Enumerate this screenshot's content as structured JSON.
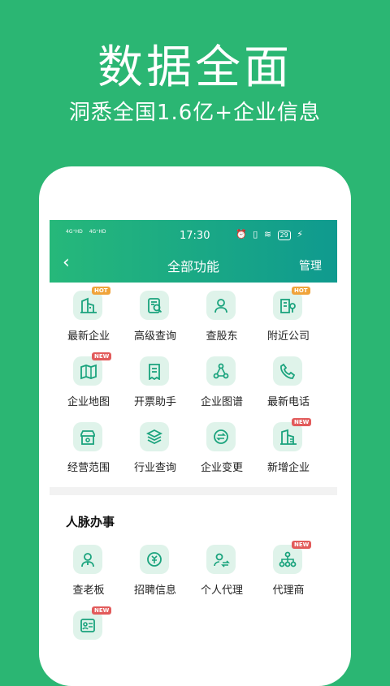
{
  "promo": {
    "title": "数据全面",
    "subtitle": "洞悉全国1.6亿+企业信息"
  },
  "status_bar": {
    "signal_1": "4G⁺HD",
    "signal_2": "4G⁺HD",
    "time": "17:30",
    "battery": "29"
  },
  "nav": {
    "back": "‹",
    "title": "全部功能",
    "manage": "管理"
  },
  "grid1": [
    {
      "label": "最新企业",
      "icon": "building-icon",
      "badge": "HOT"
    },
    {
      "label": "高级查询",
      "icon": "search-doc-icon",
      "badge": ""
    },
    {
      "label": "查股东",
      "icon": "person-icon",
      "badge": ""
    },
    {
      "label": "附近公司",
      "icon": "location-building-icon",
      "badge": "HOT"
    },
    {
      "label": "企业地图",
      "icon": "map-icon",
      "badge": "NEW"
    },
    {
      "label": "开票助手",
      "icon": "receipt-icon",
      "badge": ""
    },
    {
      "label": "企业图谱",
      "icon": "graph-icon",
      "badge": ""
    },
    {
      "label": "最新电话",
      "icon": "phone-icon",
      "badge": ""
    },
    {
      "label": "经营范围",
      "icon": "store-icon",
      "badge": ""
    },
    {
      "label": "行业查询",
      "icon": "layers-icon",
      "badge": ""
    },
    {
      "label": "企业变更",
      "icon": "exchange-icon",
      "badge": ""
    },
    {
      "label": "新增企业",
      "icon": "new-building-icon",
      "badge": "NEW"
    }
  ],
  "section": {
    "title": "人脉办事"
  },
  "grid2": [
    {
      "label": "查老板",
      "icon": "boss-icon",
      "badge": ""
    },
    {
      "label": "招聘信息",
      "icon": "recruit-icon",
      "badge": ""
    },
    {
      "label": "个人代理",
      "icon": "agent-icon",
      "badge": ""
    },
    {
      "label": "代理商",
      "icon": "org-icon",
      "badge": "NEW"
    },
    {
      "label": "",
      "icon": "card-icon",
      "badge": "NEW"
    }
  ],
  "colors": {
    "bg": "#2bb673",
    "accent": "#1aa37d",
    "hot": "#f0a33a",
    "new": "#e25b5b"
  }
}
